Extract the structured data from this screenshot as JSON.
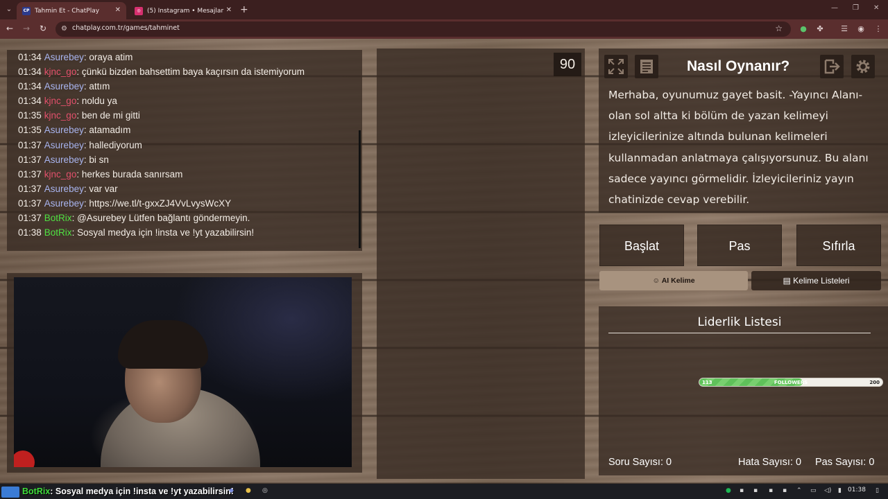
{
  "browser": {
    "tabs": [
      {
        "title": "Tahmin Et - ChatPlay",
        "favicon": "CP",
        "active": true
      },
      {
        "title": "(5) Instagram • Mesajlar",
        "favicon": "IG",
        "active": false
      }
    ],
    "url": "chatplay.com.tr/games/tahminet"
  },
  "chat": {
    "colors": {
      "Asurebey": "#a9b5f0",
      "kjnc_go": "#e2506b",
      "BotRix": "#4fe042"
    },
    "messages": [
      {
        "time": "01:34",
        "user": "Asurebey",
        "text": ": oraya atim"
      },
      {
        "time": "01:34",
        "user": "kjnc_go",
        "text": ": çünkü bizden bahsettim baya kaçırsın da istemiyorum"
      },
      {
        "time": "01:34",
        "user": "Asurebey",
        "text": ": attım"
      },
      {
        "time": "01:34",
        "user": "kjnc_go",
        "text": ": noldu ya"
      },
      {
        "time": "01:35",
        "user": "kjnc_go",
        "text": ": ben de mi gitti"
      },
      {
        "time": "01:35",
        "user": "Asurebey",
        "text": ": atamadım"
      },
      {
        "time": "01:37",
        "user": "Asurebey",
        "text": ": hallediyorum"
      },
      {
        "time": "01:37",
        "user": "Asurebey",
        "text": ": bi sn"
      },
      {
        "time": "01:37",
        "user": "kjnc_go",
        "text": ": herkes burada sanırsam"
      },
      {
        "time": "01:37",
        "user": "Asurebey",
        "text": ": var var"
      },
      {
        "time": "01:37",
        "user": "Asurebey",
        "text": ": https://we.tl/t-gxxZJ4VvLvysWcXY"
      },
      {
        "time": "01:37",
        "user": "BotRix",
        "text": ": @Asurebey Lütfen bağlantı göndermeyin."
      },
      {
        "time": "01:38",
        "user": "BotRix",
        "text": ": Sosyal medya için !insta ve !yt yazabilirsin!"
      }
    ]
  },
  "game": {
    "timer": "90",
    "howto": {
      "title": "Nasıl Oynanır?",
      "text": "Merhaba, oyunumuz gayet basit. -Yayıncı Alanı-olan sol altta ki bölüm de yazan kelimeyi izleyicilerinize altında bulunan kelimeleri kullanmadan anlatmaya çalışıyorsunuz. Bu alanı sadece yayıncı görmelidir. İzleyicileriniz yayın chatinizde cevap verebilir."
    },
    "buttons": {
      "start": "Başlat",
      "pass": "Pas",
      "reset": "Sıfırla"
    },
    "modes": {
      "ai_word": "AI Kelime",
      "word_lists": "Kelime Listeleri"
    },
    "leaderboard": {
      "title": "Liderlik Listesi"
    },
    "followers_goal": {
      "current": "113",
      "label": "FOLLOWERS",
      "target": "200",
      "fraction": 0.565
    },
    "stats": {
      "questions": "Soru Sayısı: 0",
      "errors": "Hata Sayısı: 0",
      "passes": "Pas Sayısı: 0"
    }
  },
  "taskbar": {
    "ticker_user": "BotRix",
    "ticker_text": ": Sosyal medya için !insta ve !yt yazabilirsin!",
    "clock": "01:38"
  }
}
